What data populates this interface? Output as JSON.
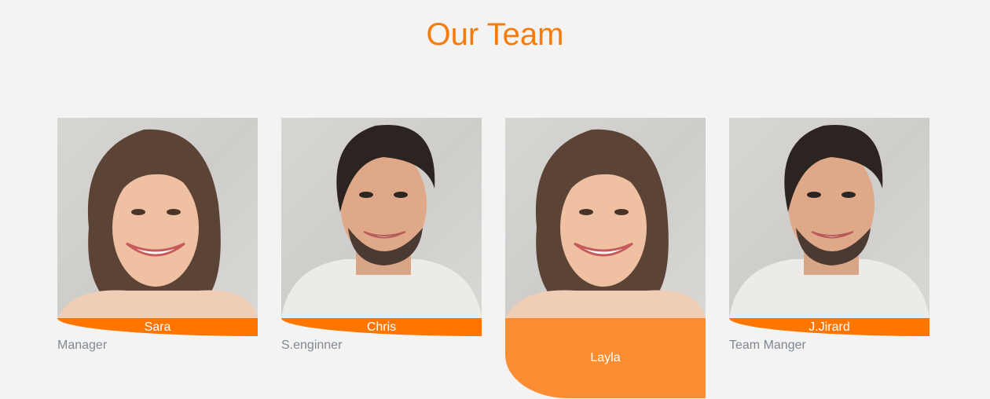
{
  "page": {
    "title": "Our Team"
  },
  "team": [
    {
      "name": "Sara",
      "role": "Manager",
      "portrait": "woman-portrait"
    },
    {
      "name": "Chris",
      "role": "S.enginner",
      "portrait": "man-portrait"
    },
    {
      "name": "Layla",
      "role": "",
      "portrait": "woman-portrait",
      "expanded": true
    },
    {
      "name": "J.Jirard",
      "role": "Team Manger",
      "portrait": "man-portrait"
    }
  ],
  "colors": {
    "accent": "#f57c0c",
    "band": "#fe7600",
    "hover_band": "#fb8d33",
    "role_text": "#808891",
    "background": "#f3f3f3"
  }
}
